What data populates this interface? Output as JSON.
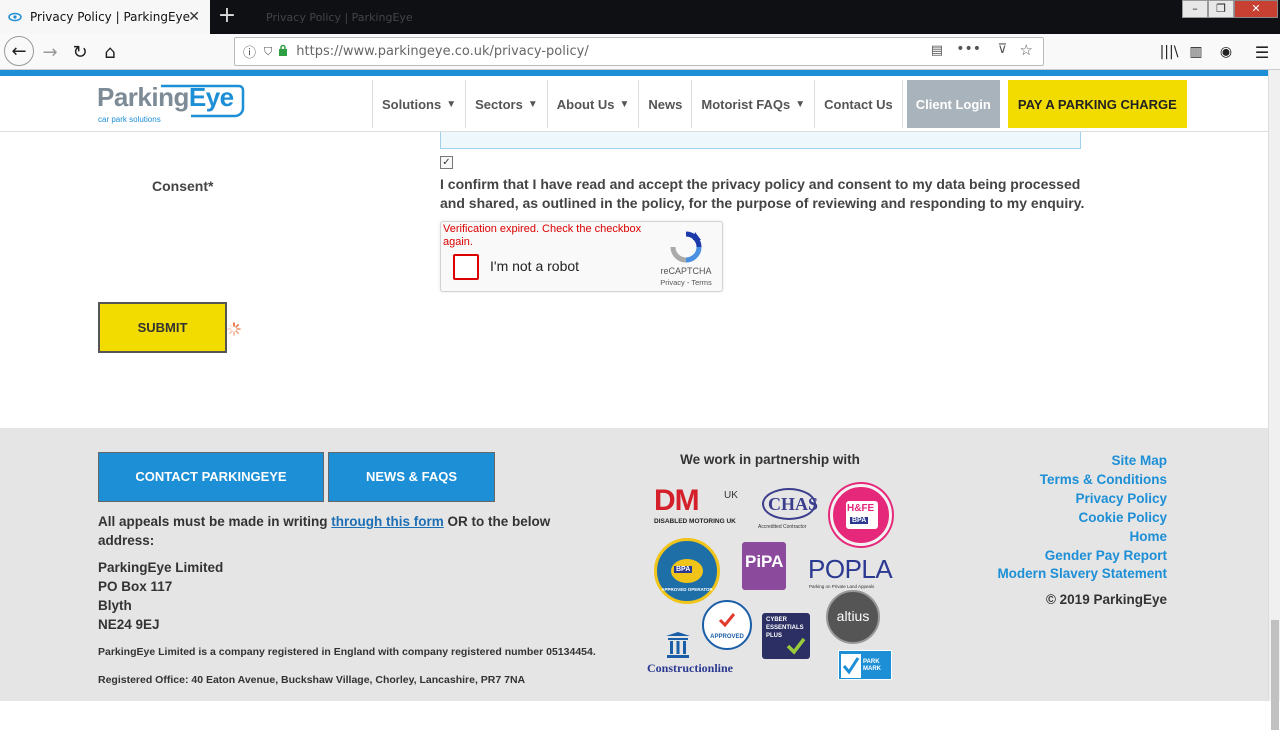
{
  "browser": {
    "tab_title": "Privacy Policy | ParkingEye",
    "background_tab_title": "Privacy Policy | ParkingEye",
    "url": "https://www.parkingeye.co.uk/privacy-policy/",
    "url_host": "https://www.parkingeye.co.uk",
    "url_path": "/privacy-policy/"
  },
  "header": {
    "logo_name_part1": "Parking",
    "logo_name_part2": "Eye",
    "logo_tagline": "car park solutions",
    "menu": [
      {
        "label": "Solutions",
        "has_dropdown": true
      },
      {
        "label": "Sectors",
        "has_dropdown": true
      },
      {
        "label": "About Us",
        "has_dropdown": true
      },
      {
        "label": "News",
        "has_dropdown": false
      },
      {
        "label": "Motorist FAQs",
        "has_dropdown": true
      },
      {
        "label": "Contact Us",
        "has_dropdown": false
      }
    ],
    "client_login": "Client Login",
    "pay_charge": "PAY A PARKING CHARGE"
  },
  "form": {
    "consent_label": "Consent*",
    "consent_checked": true,
    "consent_text": "I confirm that I have read and accept the privacy policy and consent to my data being processed and shared, as outlined in the policy, for the purpose of reviewing and responding to my enquiry.",
    "recaptcha": {
      "error": "Verification expired. Check the checkbox again.",
      "label": "I'm not a robot",
      "brand": "reCAPTCHA",
      "links": "Privacy - Terms"
    },
    "submit_label": "SUBMIT"
  },
  "footer": {
    "contact_button": "CONTACT PARKINGEYE",
    "news_button": "NEWS & FAQS",
    "appeal_before": "All appeals must be made in writing ",
    "appeal_link": "through this form",
    "appeal_after": " OR to the below address:",
    "address": [
      "ParkingEye Limited",
      "PO Box 117",
      "Blyth",
      "NE24 9EJ"
    ],
    "registration": "ParkingEye Limited is a company registered in England with company registered number 05134454.",
    "registered_office": "Registered Office: 40 Eaton Avenue, Buckshaw Village, Chorley, Lancashire, PR7 7NA",
    "partner_title": "We work in partnership with",
    "partners": {
      "dm_main": "DM",
      "dm_uk": "UK",
      "dm_sub": "DISABLED MOTORING UK",
      "chas": "CHAS",
      "chas_sub": "Accredited Contractor",
      "hfe": "H&FE",
      "bpa": "BPA",
      "approved_operator": "APPROVED OPERATOR",
      "pipa": "PiPA",
      "popla": "POPLA",
      "popla_sub": "Parking on Private Land Appeals",
      "constructionline": "Constructionline",
      "safecontractor": "APPROVED",
      "cyber_line1": "CYBER",
      "cyber_line2": "ESSENTIALS",
      "cyber_line3": "PLUS",
      "altius": "altius",
      "park_mark": "PARK MARK"
    },
    "links": [
      "Site Map",
      "Terms & Conditions",
      "Privacy Policy",
      "Cookie Policy",
      "Home",
      "Gender Pay Report",
      "Modern Slavery Statement"
    ],
    "copyright": "© 2019 ParkingEye"
  },
  "colors": {
    "brand_blue": "#1d8fd6",
    "brand_yellow": "#f2dc00",
    "footer_bg": "#e5e5e5",
    "error_red": "#dd0000"
  }
}
